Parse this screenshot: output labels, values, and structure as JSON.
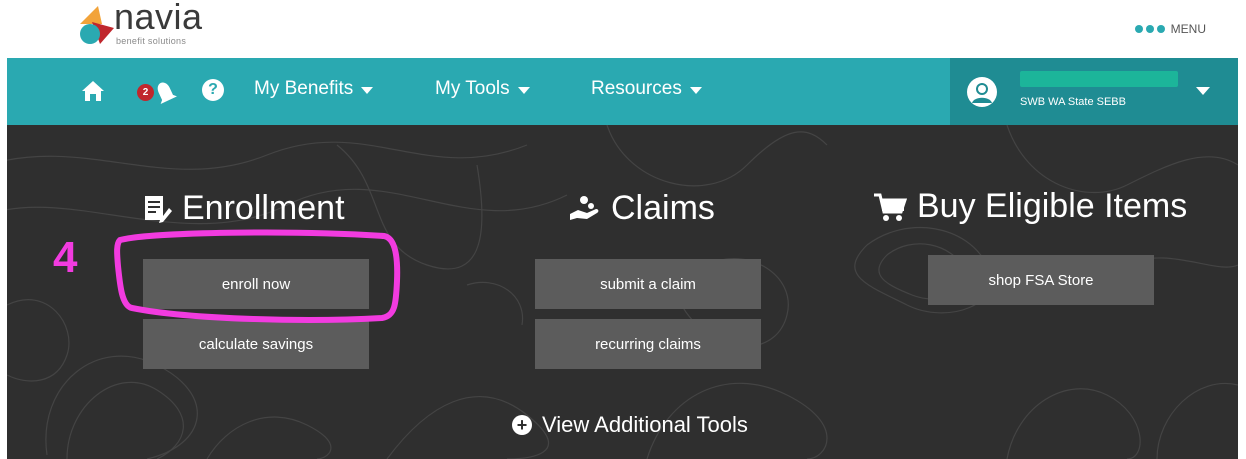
{
  "brand": {
    "name": "navia",
    "tagline": "benefit solutions"
  },
  "top_menu": {
    "label": "MENU"
  },
  "nav": {
    "notification_count": "2",
    "help_glyph": "?",
    "items": [
      {
        "label": "My Benefits"
      },
      {
        "label": "My Tools"
      },
      {
        "label": "Resources"
      }
    ],
    "account": {
      "subtitle": "SWB WA State SEBB"
    }
  },
  "sections": {
    "enrollment": {
      "title": "Enrollment",
      "buttons": [
        "enroll now",
        "calculate savings"
      ]
    },
    "claims": {
      "title": "Claims",
      "buttons": [
        "submit a claim",
        "recurring claims"
      ]
    },
    "buy": {
      "title": "Buy Eligible Items",
      "buttons": [
        "shop FSA Store"
      ]
    }
  },
  "view_additional": {
    "label": "View Additional Tools"
  },
  "annotation": {
    "step": "4"
  },
  "colors": {
    "teal": "#2aa9b1",
    "dark_teal": "#1f8c93",
    "hero": "#2f2f2f",
    "button": "#5c5c5c",
    "annotation": "#f23be0"
  },
  "icons": [
    "home-icon",
    "bell-icon",
    "help-icon",
    "user-icon",
    "document-icon",
    "hand-coins-icon",
    "cart-icon",
    "plus-circle-icon"
  ]
}
